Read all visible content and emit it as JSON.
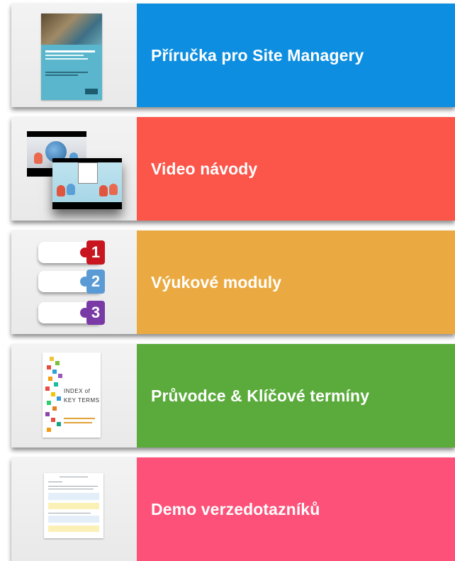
{
  "cards": [
    {
      "label": "Příručka pro Site Managery",
      "color": "#0e8ee0",
      "thumbnail_icon": "handbook-cover-icon"
    },
    {
      "label": "Video návody",
      "color": "#fc5549",
      "thumbnail_icon": "video-thumbnail-icon"
    },
    {
      "label": "Výukové moduly",
      "color": "#ebaa41",
      "thumbnail_icon": "numbered-modules-icon"
    },
    {
      "label": "Průvodce & Klíčové termíny",
      "color": "#5aab3b",
      "thumbnail_icon": "index-key-terms-cover-icon"
    },
    {
      "label": "Demo verzedotazníků",
      "color": "#fd5179",
      "thumbnail_icon": "questionnaire-preview-icon"
    }
  ],
  "modules": {
    "numbers": [
      "1",
      "2",
      "3"
    ],
    "colors": [
      "#c8151f",
      "#5b9bd5",
      "#7a3aa6"
    ]
  },
  "index_cover": {
    "title_line1": "INDEX of",
    "title_line2": "KEY TERMS"
  }
}
